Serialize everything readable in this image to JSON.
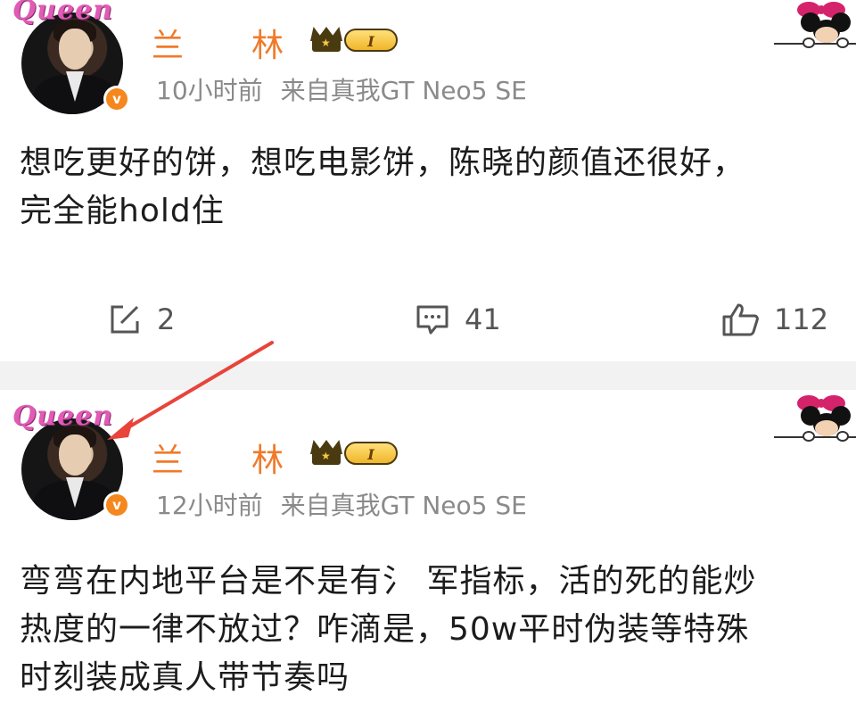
{
  "posts": [
    {
      "avatar_frame_text": "Queen",
      "verified_badge": "v",
      "name_start": "兰",
      "name_end": "林",
      "level_badge": "I",
      "time": "10小时前",
      "source": "来自",
      "device": "真我GT Neo5 SE",
      "content_lines": [
        "想吃更好的饼，想吃电影饼，陈晓的颜值还很好，",
        "完全能hold住"
      ],
      "actions": {
        "repost_count": "2",
        "comment_count": "41",
        "like_count": "112"
      }
    },
    {
      "avatar_frame_text": "Queen",
      "verified_badge": "v",
      "name_start": "兰",
      "name_end": "林",
      "level_badge": "I",
      "time": "12小时前",
      "source": "来自",
      "device": "真我GT Neo5 SE",
      "content_lines": [
        "弯弯在内地平台是不是有氵 军指标，活的死的能炒",
        "热度的一律不放过？咋滴是，50w平时伪装等特殊",
        "时刻装成真人带节奏吗"
      ]
    }
  ],
  "icons": {
    "repost": "edit-square-icon",
    "comment": "comment-bubble-icon",
    "like": "thumbs-up-icon",
    "crown": "crown-icon",
    "decoration": "minnie-mouse-sticker",
    "annotation": "red-arrow"
  },
  "colors": {
    "name": "#f07a2a",
    "meta": "#8a8a8a",
    "verified": "#f5871f",
    "separator": "#f2f2f2",
    "annotation_arrow": "#e8443a"
  }
}
